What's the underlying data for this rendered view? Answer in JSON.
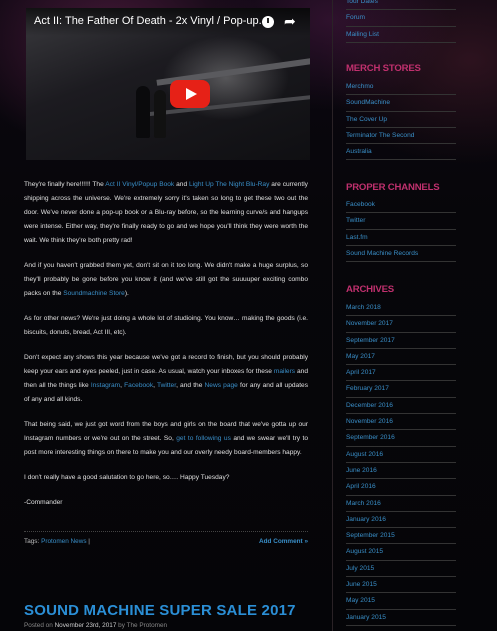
{
  "video": {
    "title": "Act II: The Father Of Death - 2x Vinyl / Pop-up...",
    "clock_icon": "clock-icon",
    "share_icon": "share-icon",
    "play_icon": "play-icon"
  },
  "post": {
    "p1": {
      "t1": "They're finally here!!!!!! The ",
      "l1": "Act II Vinyl/Popup Book",
      "t2": " and ",
      "l2": "Light Up The Night Blu-Ray",
      "t3": " are currently shipping across the universe. We're extremely sorry it's taken so long to get these two out the door. We've never done a pop-up book or a Blu-ray before, so the learning curve/s and hangups were intense. Either way, they're finally ready to go and we hope you'll think they were worth the wait. We think they're both pretty rad!"
    },
    "p2": {
      "t1": "And if you haven't grabbed them yet, don't sit on it too long. We didn't make a huge surplus, so they'll probably be gone before you know it (and we've still got the suuuuper exciting combo packs on the ",
      "l1": "Soundmachine Store",
      "t2": ")."
    },
    "p3": "As for other news? We're just doing a whole lot of studioing. You know… making the goods (i.e. biscuits, donuts, bread, Act III, etc).",
    "p4": {
      "t1": "Don't expect any shows this year because we've got a record to finish, but you should probably keep your ears and eyes peeled, just in case. As usual, watch your inboxes for these ",
      "l1": "mailers",
      "t2": " and then all the things like ",
      "l2": "Instagram",
      "t3": ", ",
      "l3": "Facebook",
      "t4": ", ",
      "l4": "Twitter",
      "t5": ", and the ",
      "l5": "News page",
      "t6": " for any and all updates of any and all kinds."
    },
    "p5": {
      "t1": "That being said, we just got word from the boys and girls on the board that we've gotta up our Instagram numbers or we're out on the street. So, ",
      "l1": "get to following us",
      "t2": " and we swear we'll try to post more interesting things on there to make you and our overly needy board-members happy."
    },
    "p6": "I don't really have a good salutation to go here, so…. Happy Tuesday?",
    "p7": "-Commander",
    "footer": {
      "tags_label": "Tags: ",
      "tag": "Protomen News",
      "sep": " |",
      "add_comment": "Add Comment »"
    }
  },
  "post2": {
    "title": "SOUND MACHINE SUPER SALE 2017",
    "posted_on": "Posted on ",
    "date": "November 23rd, 2017",
    "by": " by ",
    "author": "The Protomen"
  },
  "sidebar": {
    "top_items": [
      "Tour Dates",
      "Forum",
      "Mailing List"
    ],
    "merch_heading": "MERCH STORES",
    "merch_items": [
      "Merchmo",
      "SoundMachine",
      "The Cover Up",
      "Terminator The Second",
      "Australia"
    ],
    "channels_heading": "PROPER CHANNELS",
    "channels_items": [
      "Facebook",
      "Twitter",
      "Last.fm",
      "Sound Machine Records"
    ],
    "archives_heading": "ARCHIVES",
    "archive_items": [
      "March 2018",
      "November 2017",
      "September 2017",
      "May 2017",
      "April 2017",
      "February 2017",
      "December 2016",
      "November 2016",
      "September 2016",
      "August 2016",
      "June 2016",
      "April 2016",
      "March 2016",
      "January 2016",
      "September 2015",
      "August 2015",
      "July 2015",
      "June 2015",
      "May 2015",
      "January 2015"
    ]
  },
  "colors": {
    "link": "#3a8fc8",
    "heading": "#c0306e",
    "post_title": "#2b8fd6"
  }
}
